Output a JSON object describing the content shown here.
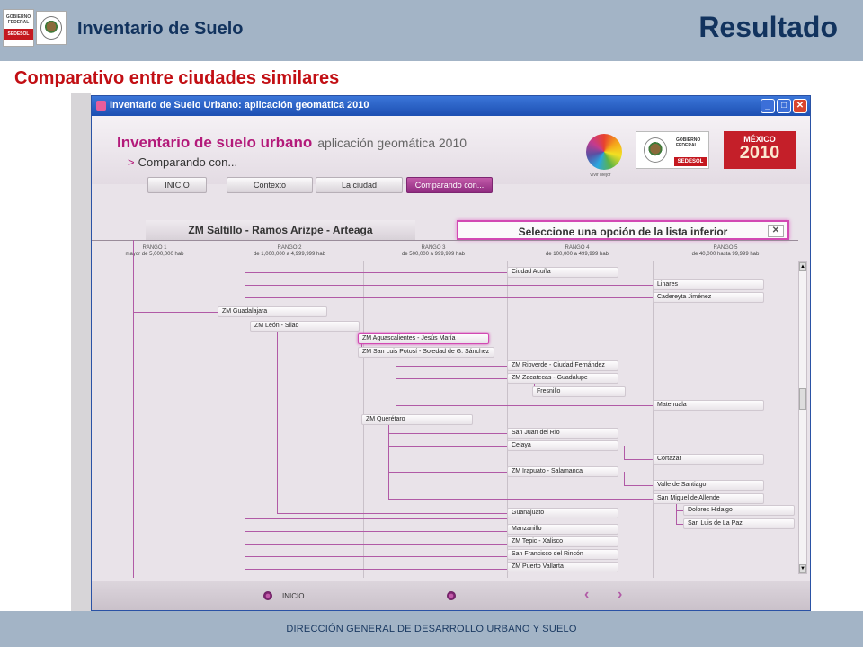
{
  "slide": {
    "app_name": "Inventario de Suelo",
    "heading": "Resultado",
    "subtitle": "Comparativo entre ciudades similares",
    "footer": "DIRECCIÓN GENERAL DE DESARROLLO URBANO Y SUELO",
    "logo": {
      "line1": "GOBIERNO",
      "line2": "FEDERAL",
      "brand": "SEDESOL"
    }
  },
  "window": {
    "title": "Inventario de Suelo Urbano: aplicación geomática 2010",
    "app_title": "Inventario de suelo urbano",
    "app_subtitle": "aplicación geomática 2010",
    "breadcrumb": "Comparando con...",
    "vivir": "Vivir Mejor",
    "gob_line1": "GOBIERNO",
    "gob_line2": "FEDERAL",
    "gob_brand": "SEDESOL",
    "mexico": "MÉXICO",
    "mexico_year": "2010",
    "tabs": [
      {
        "label": "INICIO"
      },
      {
        "label": "Contexto"
      },
      {
        "label": "La ciudad"
      },
      {
        "label": "Comparando con..."
      }
    ],
    "zm_title": "ZM Saltillo - Ramos Arizpe - Arteaga",
    "select_prompt": "Seleccione una opción de la lista inferior",
    "close_symbol": "✕",
    "ranks": [
      {
        "name": "RANGO 1",
        "range": "mayor de 5,000,000 hab"
      },
      {
        "name": "RANGO 2",
        "range": "de 1,000,000 a 4,999,999 hab"
      },
      {
        "name": "RANGO 3",
        "range": "de 500,000 a 999,999 hab"
      },
      {
        "name": "RANGO 4",
        "range": "de 100,000 a 499,999 hab"
      },
      {
        "name": "RANGO 5",
        "range": "de 40,000 hasta 99,999 hab"
      }
    ],
    "nodes": [
      "Ciudad Acuña",
      "Linares",
      "Cadereyta Jiménez",
      "ZM Guadalajara",
      "ZM León - Silao",
      "ZM Aguascalientes - Jesús María",
      "ZM San Luis Potosí - Soledad de G. Sánchez",
      "ZM Rioverde - Ciudad Fernández",
      "ZM Zacatecas - Guadalupe",
      "Fresnillo",
      "Matehuala",
      "ZM Querétaro",
      "San Juan del Río",
      "Celaya",
      "Cortazar",
      "ZM Irapuato - Salamanca",
      "Valle de Santiago",
      "San Miguel de Allende",
      "Guanajuato",
      "Dolores Hidalgo",
      "San Luis de La Paz",
      "Manzanillo",
      "ZM Tepic - Xalisco",
      "San Francisco del Rincón",
      "ZM Puerto Vallarta"
    ],
    "footer_label": "INICIO",
    "nav_prev": "‹",
    "nav_next": "›"
  }
}
